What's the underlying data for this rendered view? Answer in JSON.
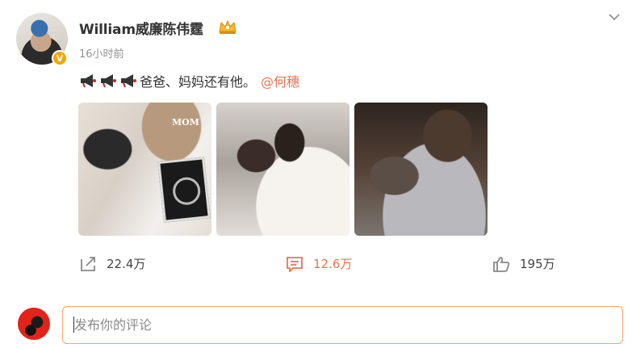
{
  "post": {
    "author": "William威廉陈伟霆",
    "timestamp": "16小时前",
    "text": "爸爸、妈妈还有他。",
    "mention": "@何穗",
    "photo_text": "MOM"
  },
  "actions": {
    "share_count": "22.4万",
    "comment_count": "12.6万",
    "like_count": "195万"
  },
  "comment_box": {
    "placeholder": "发布你的评论"
  },
  "colors": {
    "accent": "#eb7350",
    "verified": "#f7a400",
    "input_border": "#f7a26c"
  },
  "icons": [
    "verified-badge-icon",
    "vip-crown-icon",
    "chevron-down-icon",
    "megaphone-icon",
    "share-icon",
    "comment-icon",
    "like-icon"
  ]
}
